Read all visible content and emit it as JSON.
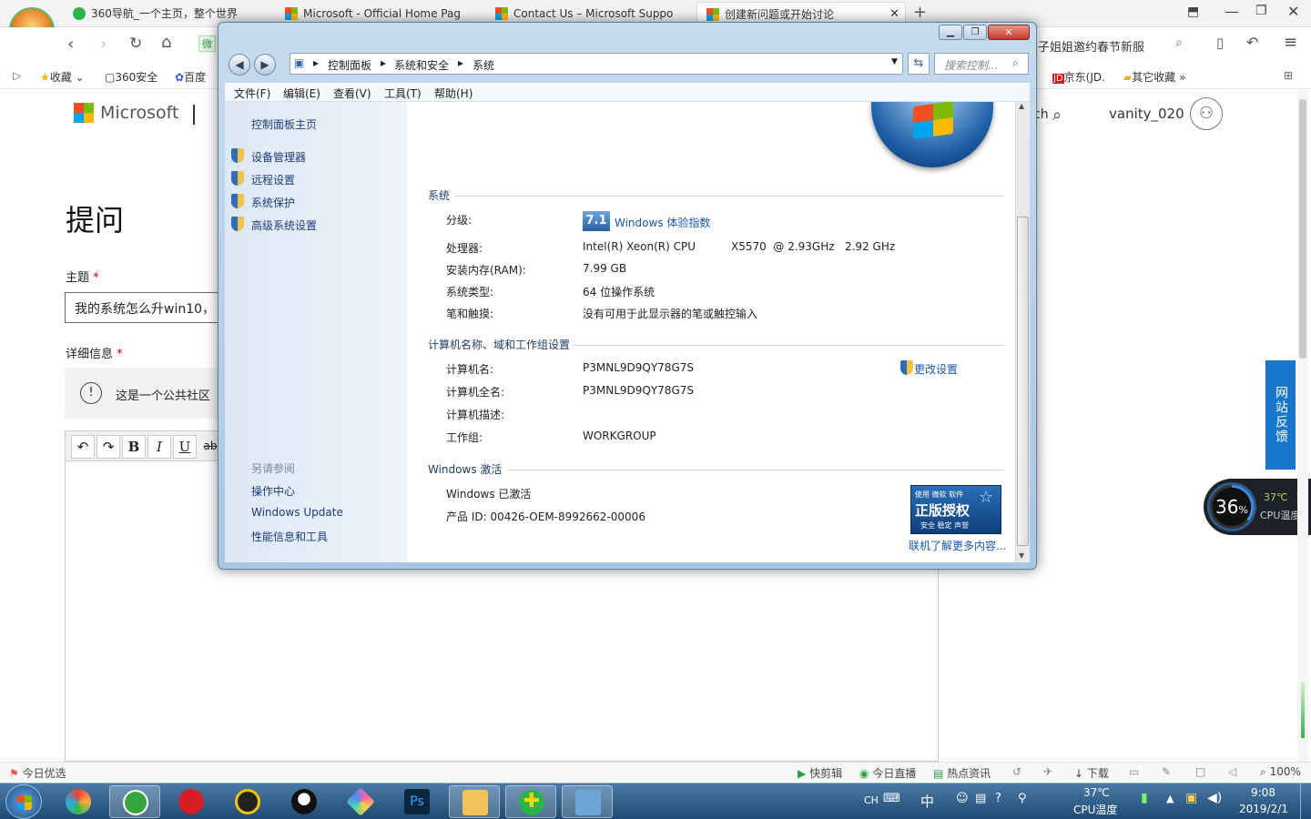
{
  "browser": {
    "tabs": [
      {
        "label": "360导航_一个主页，整个世界"
      },
      {
        "label": "Microsoft - Official Home Pag"
      },
      {
        "label": "Contact Us – Microsoft Suppo"
      },
      {
        "label": "创建新问题或开始讨论"
      }
    ],
    "nav": {
      "news_text": "子姐姐邀约春节新服",
      "badge": "微"
    },
    "bookmarks": {
      "fav": "收藏",
      "b1": "360安全",
      "b2": "百度",
      "jd": "京东(JD.",
      "other": "其它收藏"
    }
  },
  "page": {
    "brand": "Microsoft",
    "search_fragment": "ch",
    "username": "vanity_020",
    "title": "提问",
    "subject_label": "主题",
    "required": "*",
    "subject_value": "我的系统怎么升win10，",
    "details_label": "详细信息",
    "notice": "这是一个公共社区",
    "editor": {
      "b": "B",
      "i": "I",
      "u": "U",
      "s": "ab"
    },
    "feedback": "网站反馈",
    "cpu_widget": {
      "percent": "36",
      "unit": "%",
      "temp": "37℃",
      "temp_label": "CPU温度",
      "fill": 0.36
    }
  },
  "window": {
    "address": {
      "seg1": "控制面板",
      "seg2": "系统和安全",
      "seg3": "系统",
      "search_placeholder": "搜索控制..."
    },
    "menus": [
      "文件(F)",
      "编辑(E)",
      "查看(V)",
      "工具(T)",
      "帮助(H)"
    ],
    "left": {
      "home": "控制面板主页",
      "links": [
        "设备管理器",
        "远程设置",
        "系统保护",
        "高级系统设置"
      ],
      "see_also": "另请参阅",
      "see_links": [
        "操作中心",
        "Windows Update",
        "性能信息和工具"
      ]
    },
    "system": {
      "heading": "系统",
      "rating_label": "分级:",
      "rating_score": "7.1",
      "rating_link": "Windows 体验指数",
      "processor_label": "处理器:",
      "processor_a": "Intel(R) Xeon(R) CPU",
      "processor_b": "X5570  @ 2.93GHz   2.92 GHz",
      "ram_label": "安装内存(RAM):",
      "ram": "7.99 GB",
      "type_label": "系统类型:",
      "type": "64 位操作系统",
      "pen_label": "笔和触摸:",
      "pen": "没有可用于此显示器的笔或触控输入"
    },
    "computer": {
      "heading": "计算机名称、域和工作组设置",
      "name_label": "计算机名:",
      "name": "P3MNL9D9QY78G7S",
      "full_label": "计算机全名:",
      "full": "P3MNL9D9QY78G7S",
      "desc_label": "计算机描述:",
      "wg_label": "工作组:",
      "wg": "WORKGROUP",
      "change": "更改设置"
    },
    "activation": {
      "heading": "Windows 激活",
      "status": "Windows 已激活",
      "product_id": "产品 ID: 00426-OEM-8992662-00006",
      "badge_top": "使用 微软 软件",
      "badge_main": "正版授权",
      "badge_sub": "安全 稳定 声誉",
      "more": "联机了解更多内容..."
    }
  },
  "statusbar": {
    "left": "今日优选",
    "items": [
      "快剪辑",
      "今日直播",
      "热点资讯"
    ],
    "download": "下载",
    "zoom": "100%"
  },
  "taskbar": {
    "ime": "CH",
    "ime2": "中",
    "temp": "37℃",
    "temp_label": "CPU温度",
    "time": "9:08",
    "date": "2019/2/1"
  }
}
